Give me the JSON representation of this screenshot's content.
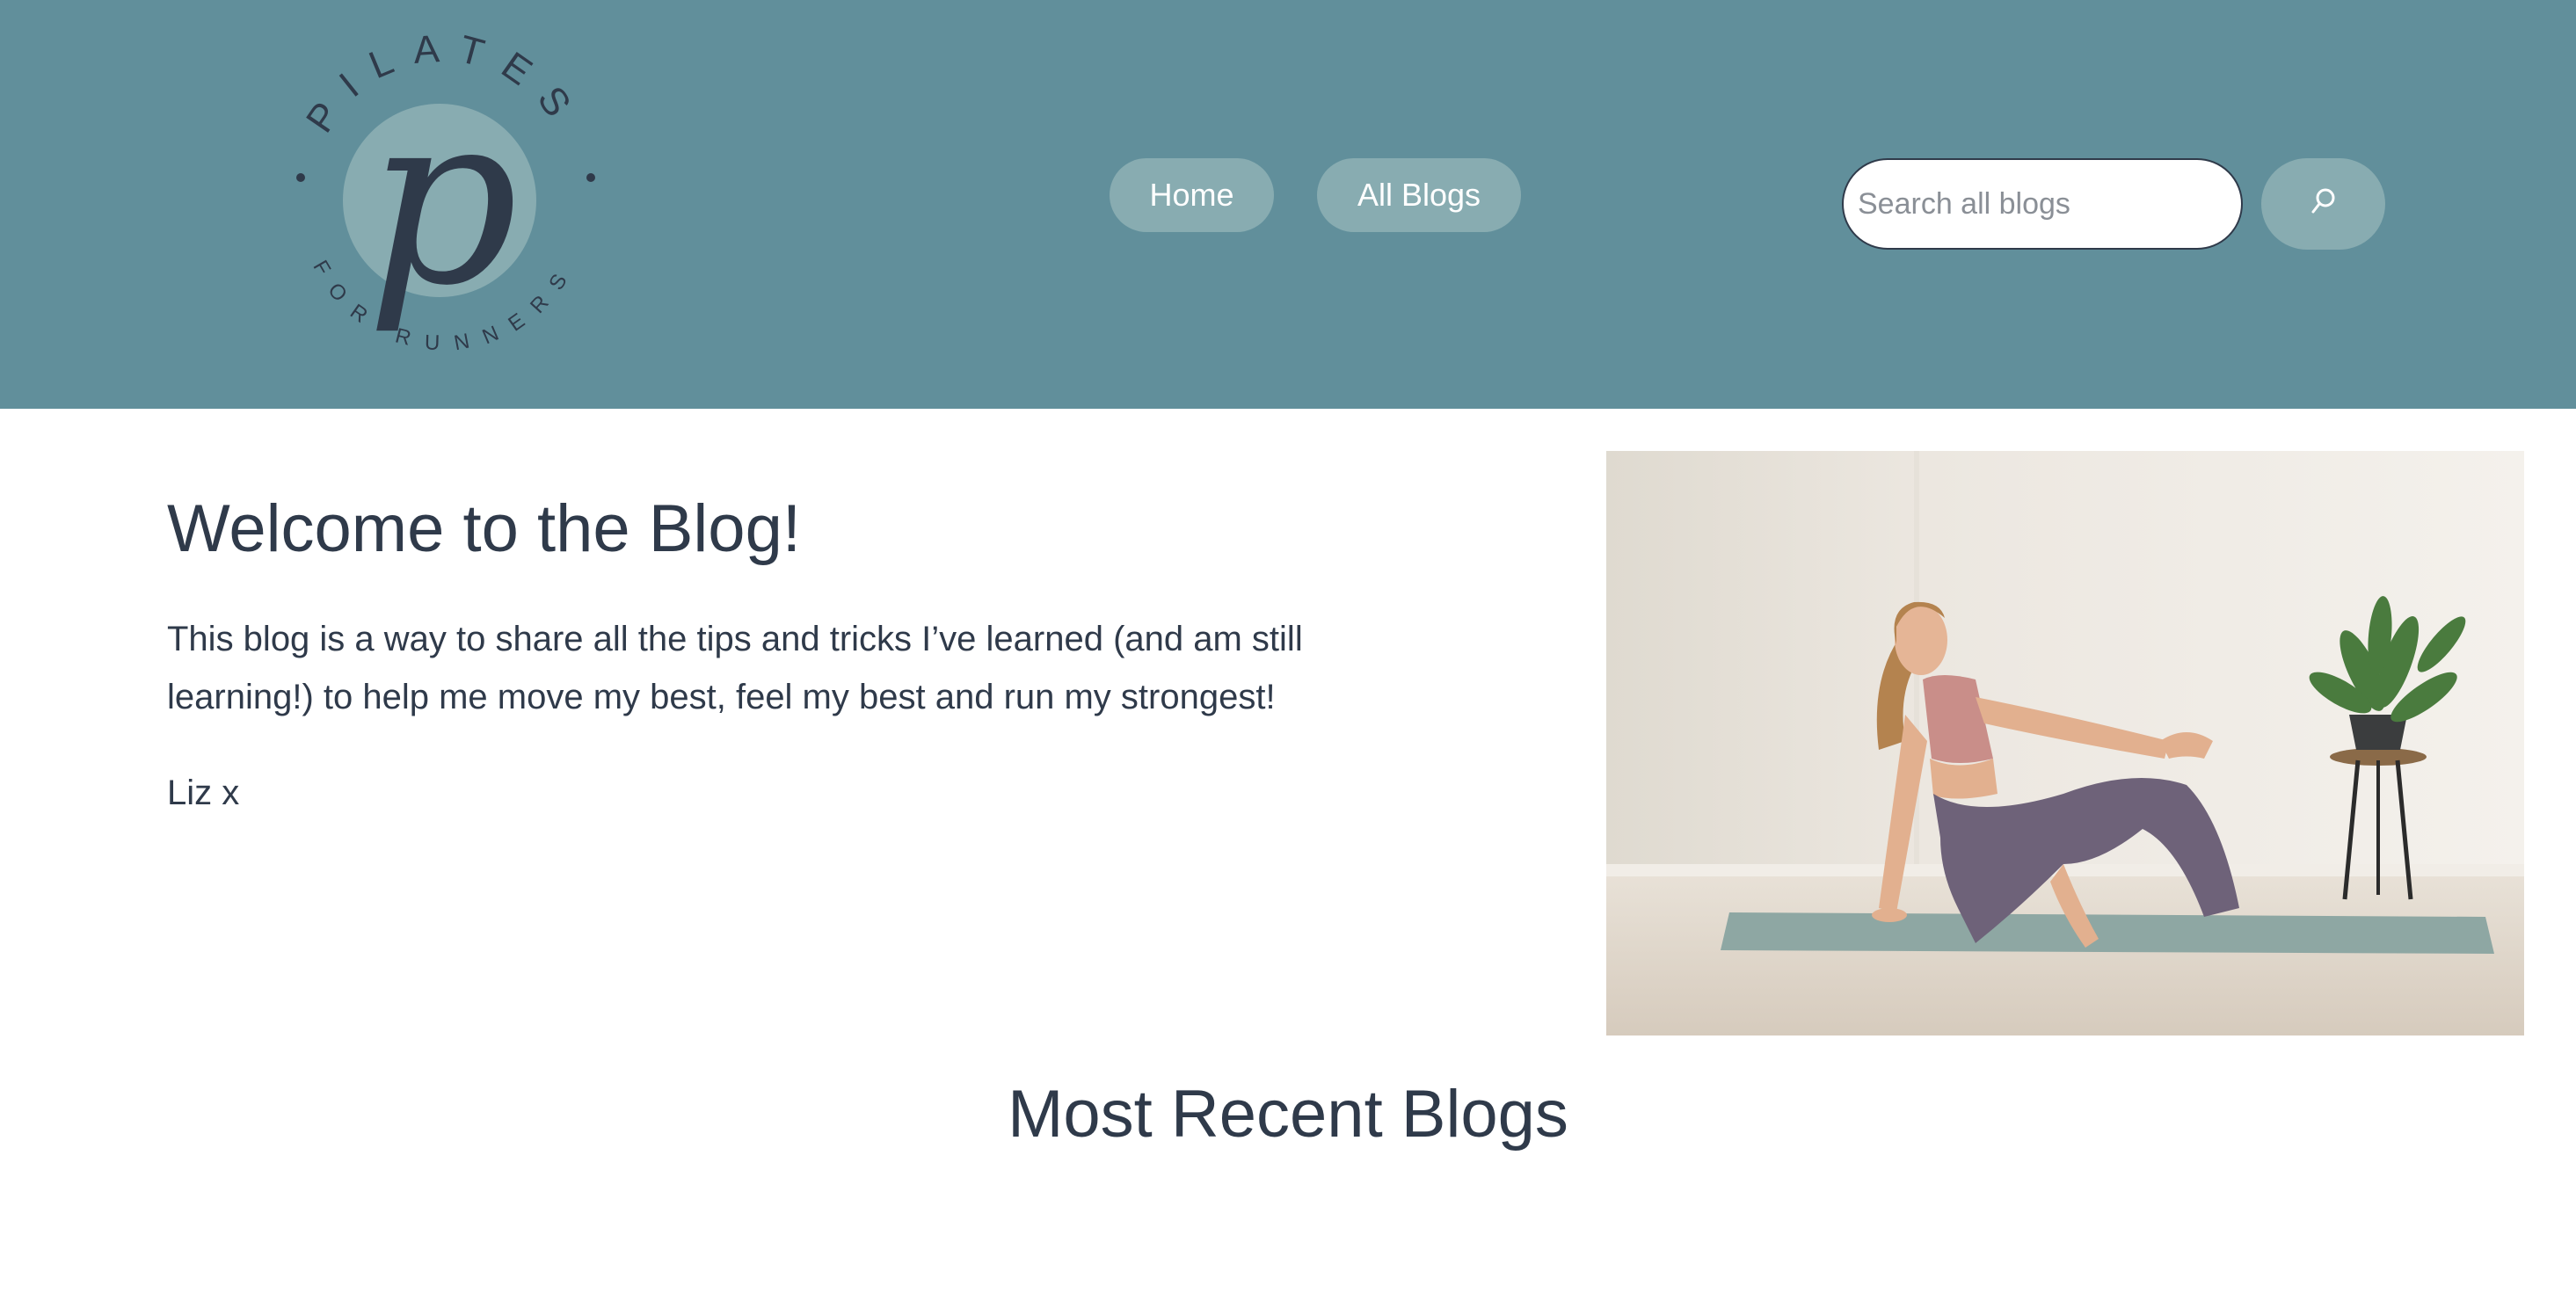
{
  "header": {
    "logo": {
      "arc_top": "PILATES",
      "arc_bottom": "FOR RUNNERS",
      "monogram": "p",
      "icon": "pilates-for-runners-logo"
    },
    "nav": [
      {
        "label": "Home"
      },
      {
        "label": "All Blogs"
      }
    ],
    "search": {
      "placeholder": "Search all blogs",
      "value": "",
      "button_icon": "search-icon"
    }
  },
  "intro": {
    "title": "Welcome to the Blog!",
    "body": "This blog is a way to share all the tips and tricks I’ve learned (and am still learning!) to help me move my best, feel my best and run my strongest!",
    "signoff": "Liz x"
  },
  "recent": {
    "title": "Most Recent Blogs"
  },
  "colors": {
    "header_bg": "#618f9b",
    "pill_bg": "#88acb1",
    "text": "#2f3a4a"
  }
}
